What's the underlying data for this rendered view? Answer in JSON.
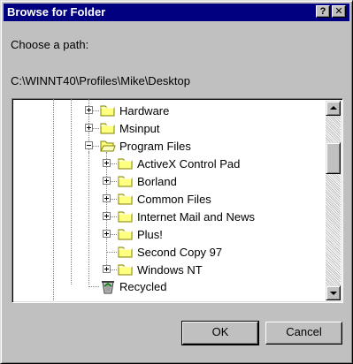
{
  "window": {
    "title": "Browse for Folder",
    "help_label": "?",
    "close_label": "✕"
  },
  "prompt": "Choose a path:",
  "current_path": "C:\\WINNT40\\Profiles\\Mike\\Desktop",
  "tree": {
    "items": [
      {
        "label": "Hardware",
        "expander": "plus",
        "icon": "folder-icon"
      },
      {
        "label": "Msinput",
        "expander": "plus",
        "icon": "folder-icon"
      },
      {
        "label": "Program Files",
        "expander": "minus",
        "icon": "open-folder-icon"
      },
      {
        "label": "ActiveX Control Pad",
        "expander": "plus",
        "icon": "folder-icon"
      },
      {
        "label": "Borland",
        "expander": "plus",
        "icon": "folder-icon"
      },
      {
        "label": "Common Files",
        "expander": "plus",
        "icon": "folder-icon"
      },
      {
        "label": "Internet Mail and News",
        "expander": "plus",
        "icon": "folder-icon"
      },
      {
        "label": "Plus!",
        "expander": "plus",
        "icon": "folder-icon"
      },
      {
        "label": "Second Copy 97",
        "expander": "none",
        "icon": "folder-icon"
      },
      {
        "label": "Windows NT",
        "expander": "plus",
        "icon": "folder-icon"
      },
      {
        "label": "Recycled",
        "expander": "none",
        "icon": "recycle-bin-icon"
      }
    ]
  },
  "buttons": {
    "ok": "OK",
    "cancel": "Cancel"
  },
  "colors": {
    "titlebar": "#000080",
    "face": "#c0c0c0",
    "folder": "#ffff80"
  }
}
